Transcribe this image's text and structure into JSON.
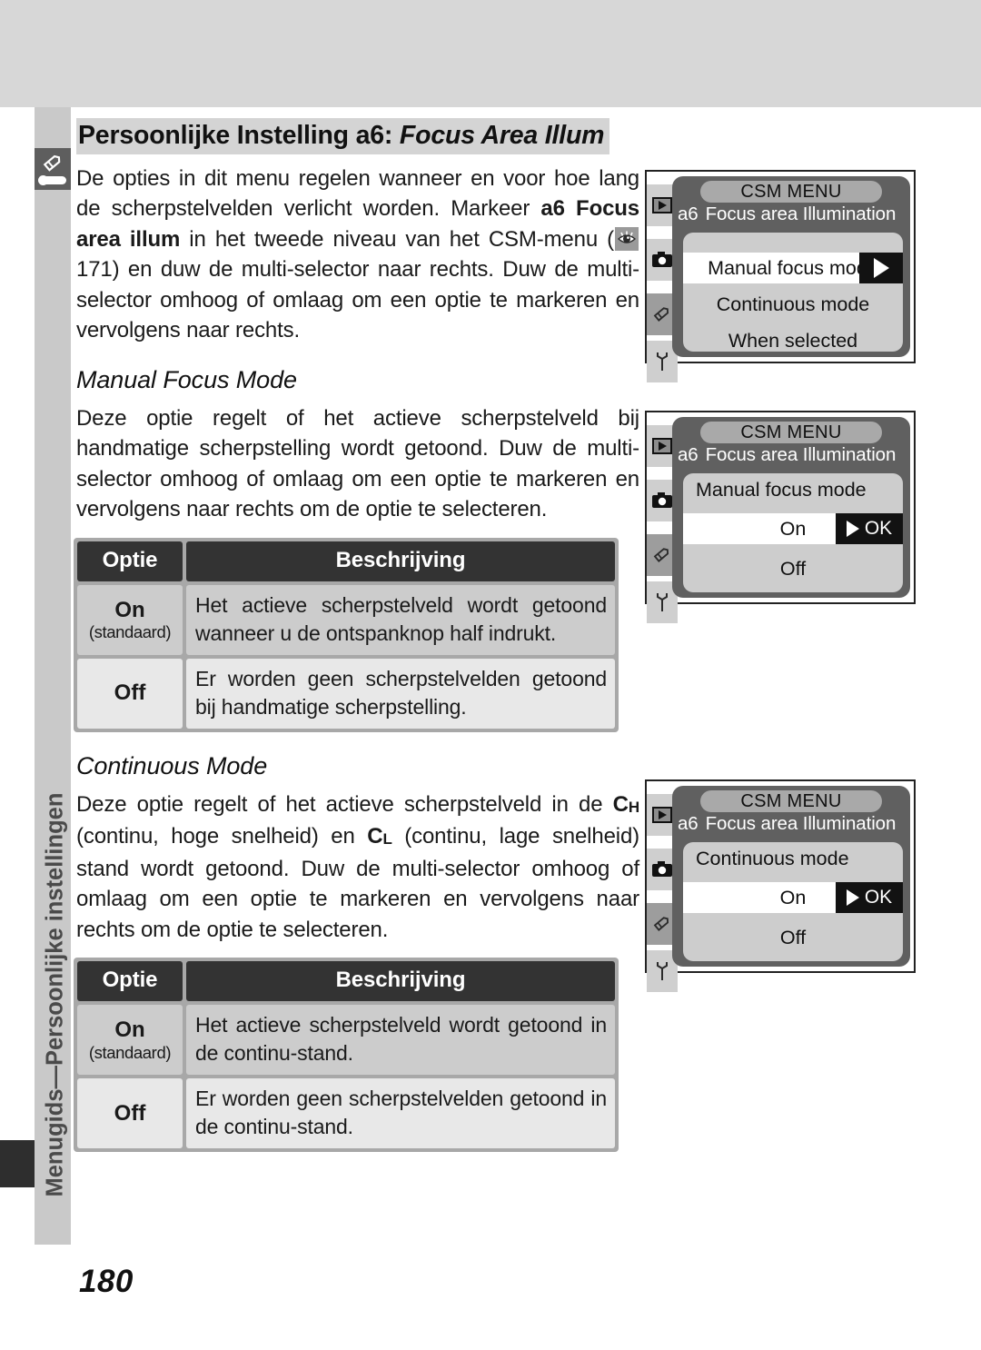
{
  "page": {
    "number": "180",
    "sidebar_label": "Menugids—Persoonlijke instellingen",
    "sidebar_icon": "pencil-icon"
  },
  "header": {
    "title_plain": "Persoonlijke Instelling a6:",
    "title_italic": "Focus Area Illum"
  },
  "intro": {
    "part1": "De opties in dit menu regelen wanneer en voor hoe lang de scherpstelvelden verlicht worden. Markeer ",
    "bold1": "a6 Focus area illum",
    "part2": " in het tweede niveau van het CSM-menu (",
    "ref_icon": "eye-icon",
    "ref_page": " 171) en duw de multi-selector naar rechts. Duw de multi-selector omhoog of omlaag om een optie te markeren en vervolgens naar rechts."
  },
  "sections": [
    {
      "heading": "Manual Focus Mode",
      "body": "Deze optie regelt of het actieve scherpstelveld bij handmatige scherpstelling wordt getoond. Duw de multi-selector omhoog of omlaag om een optie te markeren en vervolgens naar rechts om de optie te selecteren.",
      "table": {
        "headers": [
          "Optie",
          "Beschrijving"
        ],
        "rows": [
          {
            "option": "On",
            "note": "(standaard)",
            "desc": "Het actieve scherpstelveld wordt getoond wanneer u de ontspanknop half indrukt."
          },
          {
            "option": "Off",
            "note": "",
            "desc": "Er worden geen scherpstelvelden getoond bij handmatige scherpstelling."
          }
        ]
      }
    },
    {
      "heading": "Continuous Mode",
      "body_p1": "Deze optie regelt of het actieve scherpstelveld in de ",
      "mode_high": "C",
      "mode_high_sub": "H",
      "body_p2": " (continu, hoge snelheid) en ",
      "mode_low": "C",
      "mode_low_sub": "L",
      "body_p3": " (continu, lage snelheid) stand wordt getoond. Duw de multi-selector omhoog of omlaag om een optie te markeren en vervolgens naar rechts om de optie te selecteren.",
      "table": {
        "headers": [
          "Optie",
          "Beschrijving"
        ],
        "rows": [
          {
            "option": "On",
            "note": "(standaard)",
            "desc": "Het actieve scherpstelveld wordt getoond in de continu-stand."
          },
          {
            "option": "Off",
            "note": "",
            "desc": "Er worden geen scherpstelvelden getoond in de continu-stand."
          }
        ]
      }
    }
  ],
  "screens": [
    {
      "menu_title": "CSM MENU",
      "item_number": "a6",
      "item_name": "Focus area Illumination",
      "panel_label": "",
      "rows": [
        {
          "text": "Manual focus mode",
          "selected": true,
          "badge": "arrow"
        },
        {
          "text": "Continuous mode",
          "selected": false,
          "badge": ""
        },
        {
          "text": "When selected",
          "selected": false,
          "badge": ""
        }
      ],
      "tabs": [
        "playback-icon",
        "camera-icon",
        "pencil-icon",
        "wrench-icon"
      ]
    },
    {
      "menu_title": "CSM MENU",
      "item_number": "a6",
      "item_name": "Focus area Illumination",
      "panel_label": "Manual focus mode",
      "rows": [
        {
          "text": "On",
          "selected": true,
          "badge": "ok"
        },
        {
          "text": "Off",
          "selected": false,
          "badge": ""
        }
      ],
      "tabs": [
        "playback-icon",
        "camera-icon",
        "pencil-icon",
        "wrench-icon"
      ]
    },
    {
      "menu_title": "CSM MENU",
      "item_number": "a6",
      "item_name": "Focus area Illumination",
      "panel_label": "Continuous mode",
      "rows": [
        {
          "text": "On",
          "selected": true,
          "badge": "ok"
        },
        {
          "text": "Off",
          "selected": false,
          "badge": ""
        }
      ],
      "tabs": [
        "playback-icon",
        "camera-icon",
        "pencil-icon",
        "wrench-icon"
      ]
    }
  ],
  "ok_label": "OK",
  "colors": {
    "top_band": "#d7d7d7",
    "sidebar": "#c9c9c9",
    "tab_dark": "#5e5e5e",
    "table_header": "#333333",
    "row_on": "#cccccc",
    "row_off": "#e8e8e8",
    "lcd_bg": "#606060",
    "lcd_panel": "#cdcdcd"
  }
}
